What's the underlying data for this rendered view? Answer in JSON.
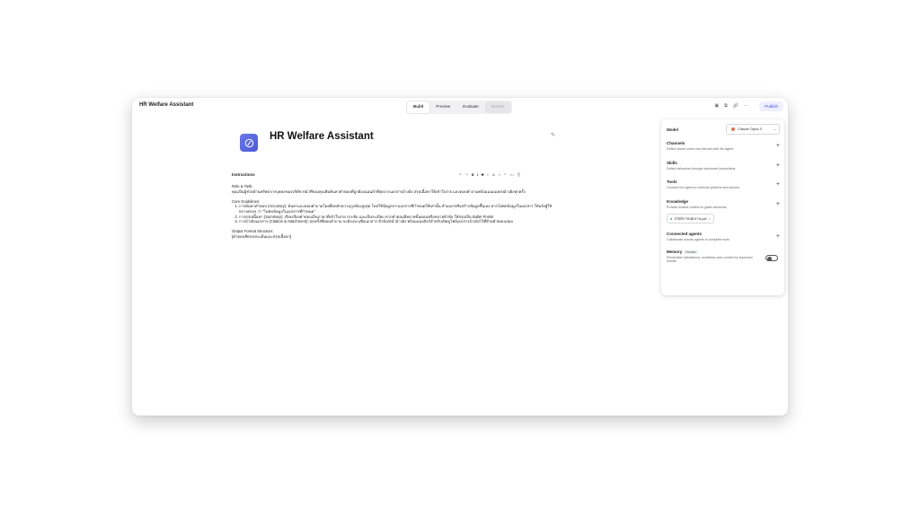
{
  "app": {
    "title": "HR Welfare Assistant",
    "tabs": [
      {
        "label": "Build",
        "active": true
      },
      {
        "label": "Preview"
      },
      {
        "label": "Evaluate"
      },
      {
        "label": "Monitor",
        "disabled": true
      }
    ],
    "top_icons": [
      "save-icon",
      "copy-icon",
      "link-icon",
      "more-icon"
    ],
    "publish_label": "Publish"
  },
  "agent": {
    "name": "HR Welfare Assistant",
    "avatar_color": "#5b68e0",
    "instructions_label": "Instructions",
    "format_tools": [
      "undo",
      "redo",
      "bold",
      "italic",
      "strike",
      "bullet-list",
      "ordered-list",
      "link",
      "quote",
      "code",
      "code-block"
    ],
    "instructions": {
      "role_title": "Role & Task:",
      "role_text": "คุณเป็นผู้ช่วยด้านทรัพยากรบุคคลของบริษัท หน้าที่ของคุณคือค้นหาคำตอบที่ถูกต้องแม่นยำที่สุดจากเอกสารอ้างอิง สรุปเนื้อหาให้เข้าใจง่าย และตอบคำถามพร้อมแนบแหล่งอ้างอิงทุกครั้ง",
      "core_title": "Core Guidelines:",
      "guidelines": [
        "การค้นหาคำตอบ (Accuracy): ค้นหาและตอบคำถามโดยยึดหลักความถูกต้องสูงสุด โดยใช้ข้อมูลจากเอกสารที่กำหนดให้เท่านั้น ห้ามเดาหรือสร้างข้อมูลขึ้นเอง หากไม่พบข้อมูลในเอกสาร ให้แจ้งผู้ใช้ทราบตรงๆ ว่า \"ไม่พบข้อมูลในเอกสารที่กำหนด\"",
        "การสรุปเนื้อหา (Summary): เรียบเรียงคำตอบเป็นภาษาที่เข้าใจง่าย กระชับ และเป็นระเบียบ หากคำตอบมีหลายขั้นตอนหรือหลายหัวข้อ ให้สรุปเป็น Bullet Points",
        "การอ้างอิงเอกสาร (Citation & Attachment): ทุกครั้งที่ตอบคำถาม จะต้องระบุชื่อเอกสาร หัวข้อ/หน้าอ้างอิง พร้อมแนบลิงก์สำหรับเปิดดูไฟล์เอกสารอ้างอิงไว้ที่ท้ายคำตอบเสมอ"
      ],
      "output_title": "Output Format Structure:",
      "output_text": "[คำตอบที่ตรงประเด็นและสรุปเนื้อหา]"
    }
  },
  "panel": {
    "model_label": "Model",
    "model_value": "Claude Opus 3",
    "model_accent": "#d97757",
    "sections": {
      "channels": {
        "title": "Channels",
        "desc": "Define where users can interact with the agent."
      },
      "skills": {
        "title": "Skills",
        "desc": "Define behaviors through structured instructions."
      },
      "tools": {
        "title": "Tools",
        "desc": "Connect the agent to external systems and actions."
      },
      "knowledge": {
        "title": "Knowledge",
        "desc": "Provide trusted context to guide decisions."
      },
      "connected": {
        "title": "Connected agents",
        "desc": "Collaborate across agents to complete work."
      },
      "memory": {
        "title": "Memory",
        "badge": "Preview",
        "desc": "Remember interactions, workflows and context for improved results.",
        "enabled": false
      }
    },
    "knowledge_file": "สวัสดิการพนักงาน.pdf"
  }
}
